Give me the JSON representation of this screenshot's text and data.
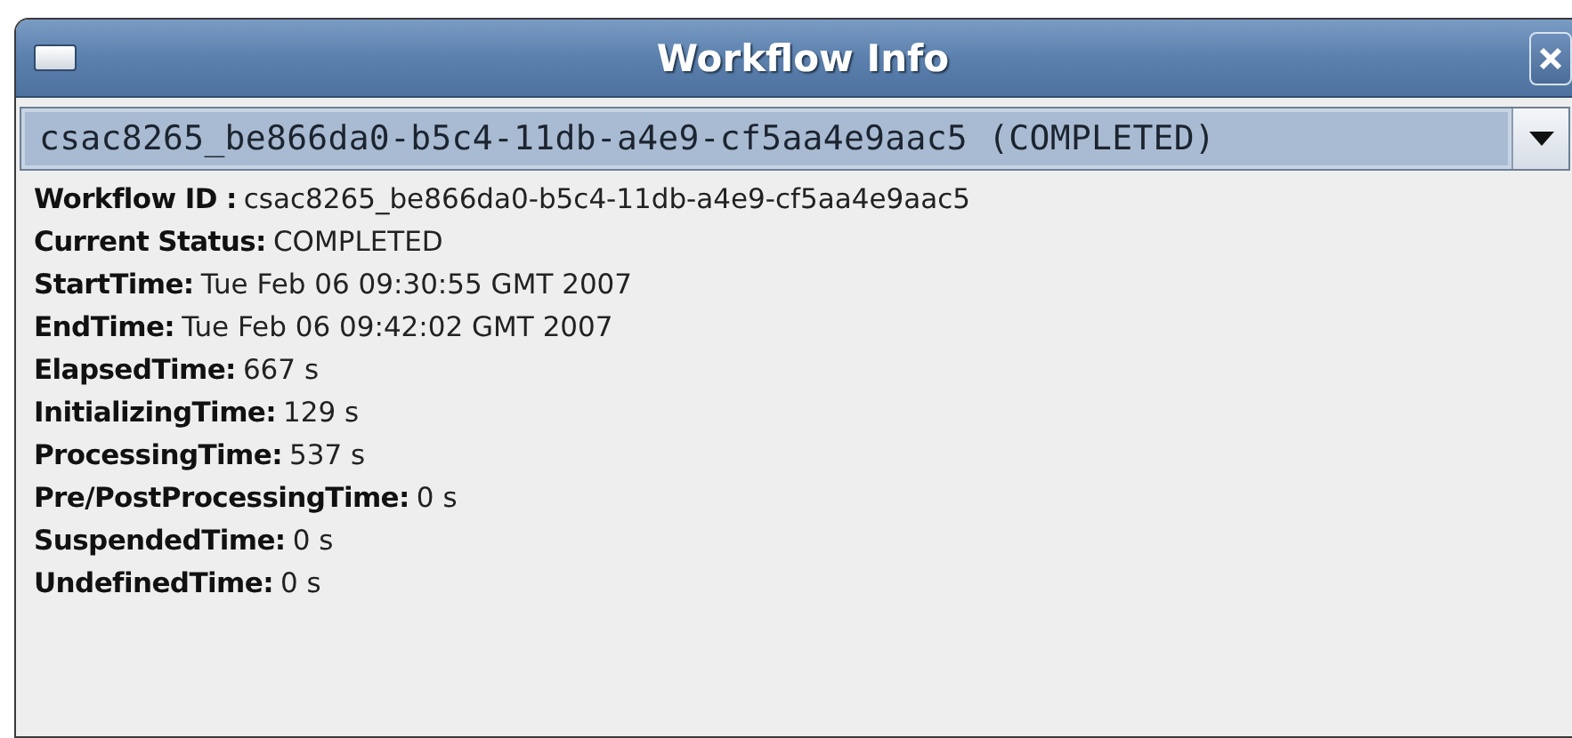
{
  "window": {
    "title": "Workflow Info"
  },
  "workflow_select": {
    "value": "csac8265_be866da0-b5c4-11db-a4e9-cf5aa4e9aac5 (COMPLETED)"
  },
  "fields": [
    {
      "label": "Workflow ID :",
      "value": "csac8265_be866da0-b5c4-11db-a4e9-cf5aa4e9aac5"
    },
    {
      "label": "Current Status:",
      "value": "COMPLETED"
    },
    {
      "label": "StartTime:",
      "value": "Tue Feb 06 09:30:55 GMT 2007"
    },
    {
      "label": "EndTime:",
      "value": "Tue Feb 06 09:42:02 GMT 2007"
    },
    {
      "label": "ElapsedTime:",
      "value": "667 s"
    },
    {
      "label": "InitializingTime:",
      "value": "129 s"
    },
    {
      "label": "ProcessingTime:",
      "value": "537 s"
    },
    {
      "label": "Pre/PostProcessingTime:",
      "value": "0 s"
    },
    {
      "label": "SuspendedTime:",
      "value": "0 s"
    },
    {
      "label": "UndefinedTime:",
      "value": "0 s"
    }
  ]
}
